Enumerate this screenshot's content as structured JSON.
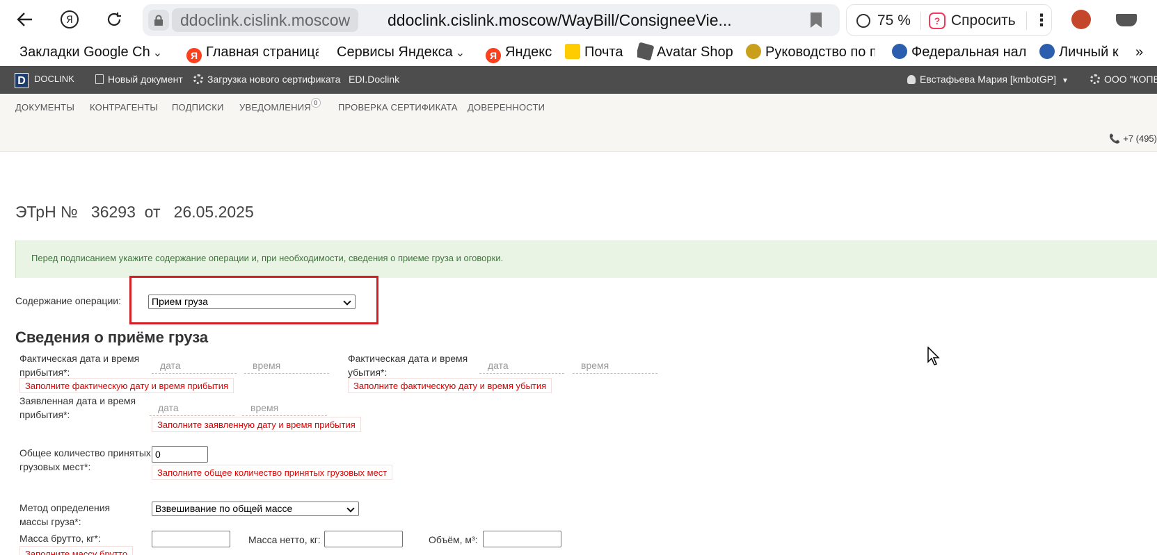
{
  "browser": {
    "domain": "ddoclink.cislink.moscow",
    "url": "ddoclink.cislink.moscow/WayBill/ConsigneeVie...",
    "zoom": "75 %",
    "ask_label": "Спросить",
    "more": "⋮"
  },
  "bookmarks": [
    "Закладки Google Ch",
    "Главная страница",
    "Сервисы Яндекса",
    "Яндекс",
    "Почта",
    "Avatar Shop",
    "Руководство по п",
    "Федеральная нал",
    "Личный к"
  ],
  "bookmarks_more": "»",
  "header": {
    "logo": "D",
    "brand": "DOCLINK",
    "new_doc": "Новый документ",
    "upload_cert": "Загрузка нового сертификата",
    "edi": "EDI.Doclink",
    "user": "Евстафьева Мария [kmbotGP]",
    "org": "ООО \"КОПЕ"
  },
  "subnav": {
    "items": [
      "ДОКУМЕНТЫ",
      "КОНТРАГЕНТЫ",
      "ПОДПИСКИ",
      "УВЕДОМЛЕНИЯ",
      "ПРОВЕРКА СЕРТИФИКАТА",
      "ДОВЕРЕННОСТИ"
    ],
    "notifications_count": "0",
    "phone": "+7 (495)"
  },
  "doc": {
    "title": "ЭТрН №   36293  от   26.05.2025",
    "info": "Перед подписанием укажите содержание операции и, при необходимости, сведения о приеме груза и оговорки."
  },
  "operation": {
    "label": "Содержание операции:",
    "value": "Прием груза"
  },
  "section_title": "Сведения о приёме груза",
  "form": {
    "actual_arrival": {
      "label": "Фактическая дата и время прибытия*:",
      "date_placeholder": "дата",
      "time_placeholder": "время",
      "error": "Заполните фактическую дату и время прибытия"
    },
    "actual_departure": {
      "label": "Фактическая дата и время убытия*:",
      "date_placeholder": "дата",
      "time_placeholder": "время",
      "error": "Заполните фактическую дату и время убытия"
    },
    "declared_arrival": {
      "label": "Заявленная дата и время прибытия*:",
      "date_placeholder": "дата",
      "time_placeholder": "время",
      "error": "Заполните заявленную дату и время прибытия"
    },
    "total_places": {
      "label": "Общее количество принятых грузовых мест*:",
      "value": "0",
      "error": "Заполните общее количество принятых грузовых мест"
    },
    "mass_method": {
      "label": "Метод определения массы груза*:",
      "value": "Взвешивание по общей массе"
    },
    "gross_mass": {
      "label": "Масса брутто, кг*:",
      "error": "Заполните массу брутто"
    },
    "net_mass": {
      "label": "Масса нетто, кг:"
    },
    "volume": {
      "label": "Объём, м³:"
    }
  }
}
